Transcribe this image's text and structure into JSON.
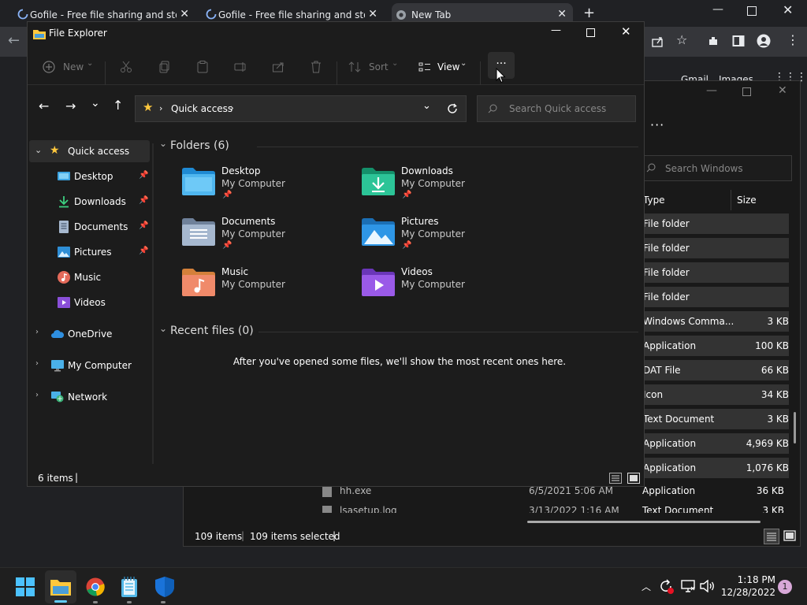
{
  "chrome": {
    "tabs": [
      {
        "title": "Gofile - Free file sharing and stor"
      },
      {
        "title": "Gofile - Free file sharing and stor"
      },
      {
        "title": "New Tab"
      }
    ],
    "google_links": [
      "Gmail",
      "Images"
    ]
  },
  "bg_explorer": {
    "search_placeholder": "Search Windows",
    "col_type": "Type",
    "col_size": "Size",
    "rows": [
      {
        "type": "File folder",
        "size": ""
      },
      {
        "type": "File folder",
        "size": ""
      },
      {
        "type": "File folder",
        "size": ""
      },
      {
        "type": "File folder",
        "size": ""
      },
      {
        "type": "Windows Comma...",
        "size": "3 KB"
      },
      {
        "type": "Application",
        "size": "100 KB"
      },
      {
        "type": "DAT File",
        "size": "66 KB"
      },
      {
        "type": "Icon",
        "size": "34 KB"
      },
      {
        "type": "Text Document",
        "size": "3 KB"
      },
      {
        "type": "Application",
        "size": "4,969 KB"
      },
      {
        "type": "Application",
        "size": "1,076 KB"
      }
    ],
    "visible_row": {
      "name": "hh.exe",
      "date": "6/5/2021 5:06 AM",
      "type": "Application",
      "size": "36 KB"
    },
    "cut_row": {
      "name": "lsasetup.log",
      "date": "3/13/2022 1:16 AM",
      "type": "Text Document",
      "size": "3 KB"
    },
    "status_items": "109 items",
    "status_selected": "109 items selected"
  },
  "explorer": {
    "title": "File Explorer",
    "commands": {
      "new": "New",
      "sort": "Sort",
      "view": "View",
      "more": "···"
    },
    "address": {
      "location": "Quick access"
    },
    "search_placeholder": "Search Quick access",
    "nav": {
      "quick_access": "Quick access",
      "desktop": "Desktop",
      "downloads": "Downloads",
      "documents": "Documents",
      "pictures": "Pictures",
      "music": "Music",
      "videos": "Videos",
      "onedrive": "OneDrive",
      "mycomputer": "My Computer",
      "network": "Network"
    },
    "folders_header": "Folders (6)",
    "folders": [
      {
        "name": "Desktop",
        "location": "My Computer"
      },
      {
        "name": "Downloads",
        "location": "My Computer"
      },
      {
        "name": "Documents",
        "location": "My Computer"
      },
      {
        "name": "Pictures",
        "location": "My Computer"
      },
      {
        "name": "Music",
        "location": "My Computer"
      },
      {
        "name": "Videos",
        "location": "My Computer"
      }
    ],
    "recent_header": "Recent files (0)",
    "recent_empty": "After you've opened some files, we'll show the most recent ones here.",
    "status": "6 items"
  },
  "taskbar": {
    "time": "1:18 PM",
    "date": "12/28/2022",
    "notification_count": "1"
  },
  "colors": {
    "accent": "#60cdff",
    "folder_yellow": "#ffc83d"
  }
}
